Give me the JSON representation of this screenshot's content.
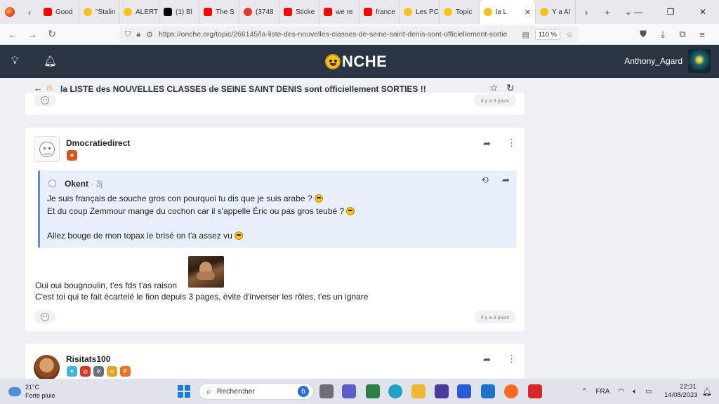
{
  "browser": {
    "tabs": [
      {
        "label": "Good",
        "fav": "yt"
      },
      {
        "label": "\"Stalin",
        "fav": "on"
      },
      {
        "label": "ALERT",
        "fav": "on"
      },
      {
        "label": "(1) Bl",
        "fav": "x"
      },
      {
        "label": "The S",
        "fav": "yt"
      },
      {
        "label": "(3748",
        "fav": "r"
      },
      {
        "label": "Sticke",
        "fav": "yt"
      },
      {
        "label": "we re",
        "fav": "yt"
      },
      {
        "label": "france",
        "fav": "yt"
      },
      {
        "label": "Les PC",
        "fav": "on"
      },
      {
        "label": "Topic",
        "fav": "on"
      }
    ],
    "active_tab": {
      "label": "la L"
    },
    "after_tab": {
      "label": "Y a Al"
    },
    "url": "https://onche.org/topic/266145/la-liste-des-nouvelles-classes-de-seine-saint-denis-sont-officiellement-sortie",
    "zoom": "110 %"
  },
  "site": {
    "logo_text": "NCHE",
    "username": "Anthony_Agard"
  },
  "topic": {
    "title": "la LISTE des NOUVELLES CLASSES de SEINE SAINT DENIS sont officiellement SORTIES !!"
  },
  "prev_post": {
    "date": "il y a 3 jours"
  },
  "post": {
    "author": "Dmocratiedirect",
    "quote": {
      "author": "Okent",
      "age": "3j",
      "dot": "·",
      "line1": "Je suis français de souche gros con pourquoi tu dis que je suis arabe ?",
      "line2": "Et du coup Zemmour mange du cochon car il s'appelle Éric ou pas gros teubé ?",
      "line3": "Allez bouge de mon topax le brisé on t'a assez vu"
    },
    "line1": "Oui oui bougnoulin, t'es fds t'as raison",
    "line2": "C'est toi qui te fait écartelé le fion depuis 3 pages, évite d'inverser les rôles, t'es un ignare",
    "date": "il y a 3 jours"
  },
  "next_post": {
    "author": "Risitats100"
  },
  "taskbar": {
    "temp": "21°C",
    "weather": "Forte pluie",
    "search_placeholder": "Rechercher",
    "lang": "FRA",
    "time": "22:31",
    "date": "14/08/2023"
  },
  "colors": {
    "header_bg": "#2b3442",
    "quote_bg": "#eaf0fb",
    "quote_border": "#6b8be0",
    "page_bg": "#eef0f3"
  }
}
